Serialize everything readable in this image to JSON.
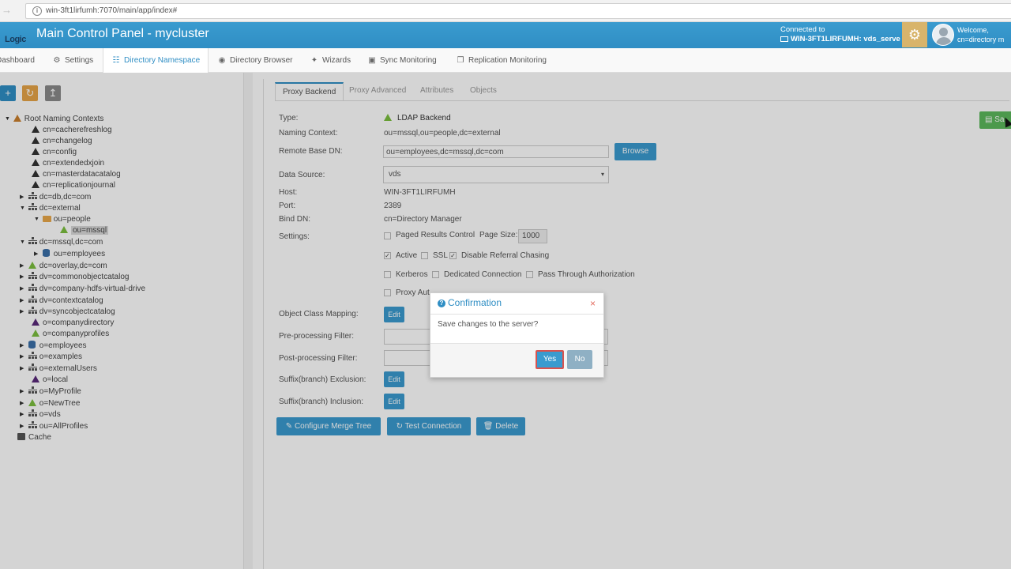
{
  "browser": {
    "url": "win-3ft1lirfumh:7070/main/app/index#"
  },
  "header": {
    "logo_top": "",
    "logo_bottom": "Logic",
    "title": "Main Control Panel - mycluster",
    "connected_label": "Connected to",
    "connected_server": "WIN-3FT1LIRFUMH: vds_serve",
    "welcome_label": "Welcome,",
    "welcome_user": "cn=directory m"
  },
  "nav": {
    "items": [
      {
        "label": "Dashboard",
        "icon": "dashboard-icon"
      },
      {
        "label": "Settings",
        "icon": "gears-icon"
      },
      {
        "label": "Directory Namespace",
        "icon": "sitemap-icon",
        "active": true
      },
      {
        "label": "Directory Browser",
        "icon": "globe-icon"
      },
      {
        "label": "Wizards",
        "icon": "magic-wand-icon"
      },
      {
        "label": "Sync Monitoring",
        "icon": "monitor-icon"
      },
      {
        "label": "Replication Monitoring",
        "icon": "copy-icon"
      }
    ]
  },
  "tree": {
    "nodes": [
      {
        "label": "Root Naming Contexts",
        "icon": "orange-triangle",
        "toggle": "open"
      },
      {
        "label": "cn=cacherefreshlog",
        "icon": "black-triangle"
      },
      {
        "label": "cn=changelog",
        "icon": "black-triangle"
      },
      {
        "label": "cn=config",
        "icon": "black-triangle"
      },
      {
        "label": "cn=extendedxjoin",
        "icon": "black-triangle"
      },
      {
        "label": "cn=masterdatacatalog",
        "icon": "black-triangle"
      },
      {
        "label": "cn=replicationjournal",
        "icon": "black-triangle"
      },
      {
        "label": "dc=db,dc=com",
        "icon": "org-icon",
        "toggle": "closed"
      },
      {
        "label": "dc=external",
        "icon": "org-icon",
        "toggle": "open"
      },
      {
        "label": "ou=people",
        "icon": "folder-icon",
        "toggle": "open"
      },
      {
        "label": "ou=mssql",
        "icon": "green-triangle",
        "selected": true
      },
      {
        "label": "dc=mssql,dc=com",
        "icon": "org-icon",
        "toggle": "open"
      },
      {
        "label": "ou=employees",
        "icon": "database-icon",
        "toggle": "closed"
      },
      {
        "label": "dc=overlay,dc=com",
        "icon": "green-triangle",
        "toggle": "closed"
      },
      {
        "label": "dv=commonobjectcatalog",
        "icon": "org-icon",
        "toggle": "closed"
      },
      {
        "label": "dv=company-hdfs-virtual-drive",
        "icon": "org-icon",
        "toggle": "closed"
      },
      {
        "label": "dv=contextcatalog",
        "icon": "org-icon",
        "toggle": "closed"
      },
      {
        "label": "dv=syncobjectcatalog",
        "icon": "org-icon",
        "toggle": "closed"
      },
      {
        "label": "o=companydirectory",
        "icon": "purple-triangle"
      },
      {
        "label": "o=companyprofiles",
        "icon": "green-triangle"
      },
      {
        "label": "o=employees",
        "icon": "database-icon",
        "toggle": "closed"
      },
      {
        "label": "o=examples",
        "icon": "org-icon",
        "toggle": "closed"
      },
      {
        "label": "o=externalUsers",
        "icon": "org-icon",
        "toggle": "closed"
      },
      {
        "label": "o=local",
        "icon": "purple-triangle"
      },
      {
        "label": "o=MyProfile",
        "icon": "org-icon",
        "toggle": "closed"
      },
      {
        "label": "o=NewTree",
        "icon": "green-triangle",
        "toggle": "closed"
      },
      {
        "label": "o=vds",
        "icon": "org-icon",
        "toggle": "closed"
      },
      {
        "label": "ou=AllProfiles",
        "icon": "org-icon",
        "toggle": "closed"
      },
      {
        "label": "Cache",
        "icon": "cache-icon"
      }
    ]
  },
  "tabs": [
    "Proxy Backend",
    "Proxy Advanced",
    "Attributes",
    "Objects"
  ],
  "form": {
    "type_label": "Type:",
    "type_value": "LDAP Backend",
    "naming_context_label": "Naming Context:",
    "naming_context_value": "ou=mssql,ou=people,dc=external",
    "remote_base_dn_label": "Remote Base DN:",
    "remote_base_dn_value": "ou=employees,dc=mssql,dc=com",
    "browse_label": "Browse",
    "data_source_label": "Data Source:",
    "data_source_value": "vds",
    "host_label": "Host:",
    "host_value": "WIN-3FT1LIRFUMH",
    "port_label": "Port:",
    "port_value": "2389",
    "bind_dn_label": "Bind DN:",
    "bind_dn_value": "cn=Directory Manager",
    "settings_label": "Settings:",
    "paged_results_label": "Paged Results Control",
    "page_size_label": "Page Size:",
    "page_size_value": "1000",
    "active_label": "Active",
    "ssl_label": "SSL",
    "disable_referral_label": "Disable Referral Chasing",
    "kerberos_label": "Kerberos",
    "dedicated_connection_label": "Dedicated Connection",
    "pass_through_label": "Pass Through Authorization",
    "proxy_auth_label": "Proxy Aut",
    "object_class_mapping_label": "Object Class Mapping:",
    "edit_label": "Edit",
    "pre_processing_label": "Pre-processing Filter:",
    "post_processing_label": "Post-processing Filter:",
    "suffix_exclusion_label": "Suffix(branch) Exclusion:",
    "suffix_inclusion_label": "Suffix(branch) Inclusion:",
    "configure_merge_tree_label": "Configure Merge Tree",
    "test_connection_label": "Test Connection",
    "delete_label": "Delete",
    "save_label": "Sa"
  },
  "dialog": {
    "title": "Confirmation",
    "message": "Save changes to the server?",
    "yes_label": "Yes",
    "no_label": "No",
    "close_glyph": "×"
  },
  "colors": {
    "header_blue": "#2f8ec4",
    "button_blue": "#3a9bcf",
    "save_green": "#5cb85c",
    "gear_tan": "#d8b46b",
    "close_red": "#e36b5e"
  }
}
